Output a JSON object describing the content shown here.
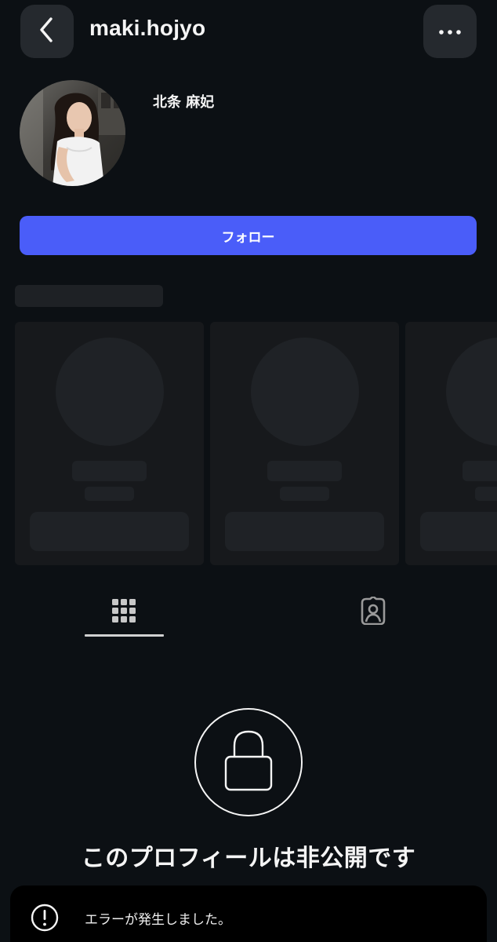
{
  "header": {
    "username": "maki.hojyo",
    "back_icon": "chevron-left-icon",
    "more_icon": "more-horizontal-icon"
  },
  "profile": {
    "display_name": "北条 麻妃",
    "follow_label": "フォロー"
  },
  "tabs": [
    {
      "icon": "grid-icon",
      "selected": true
    },
    {
      "icon": "tagged-user-icon",
      "selected": false
    }
  ],
  "private_notice": {
    "icon": "lock-icon",
    "text": "このプロフィールは非公開です"
  },
  "toast": {
    "icon": "alert-circle-icon",
    "message": "エラーが発生しました。"
  },
  "colors": {
    "background": "#0c1014",
    "accent": "#4a5df9",
    "surface": "#25292e"
  }
}
